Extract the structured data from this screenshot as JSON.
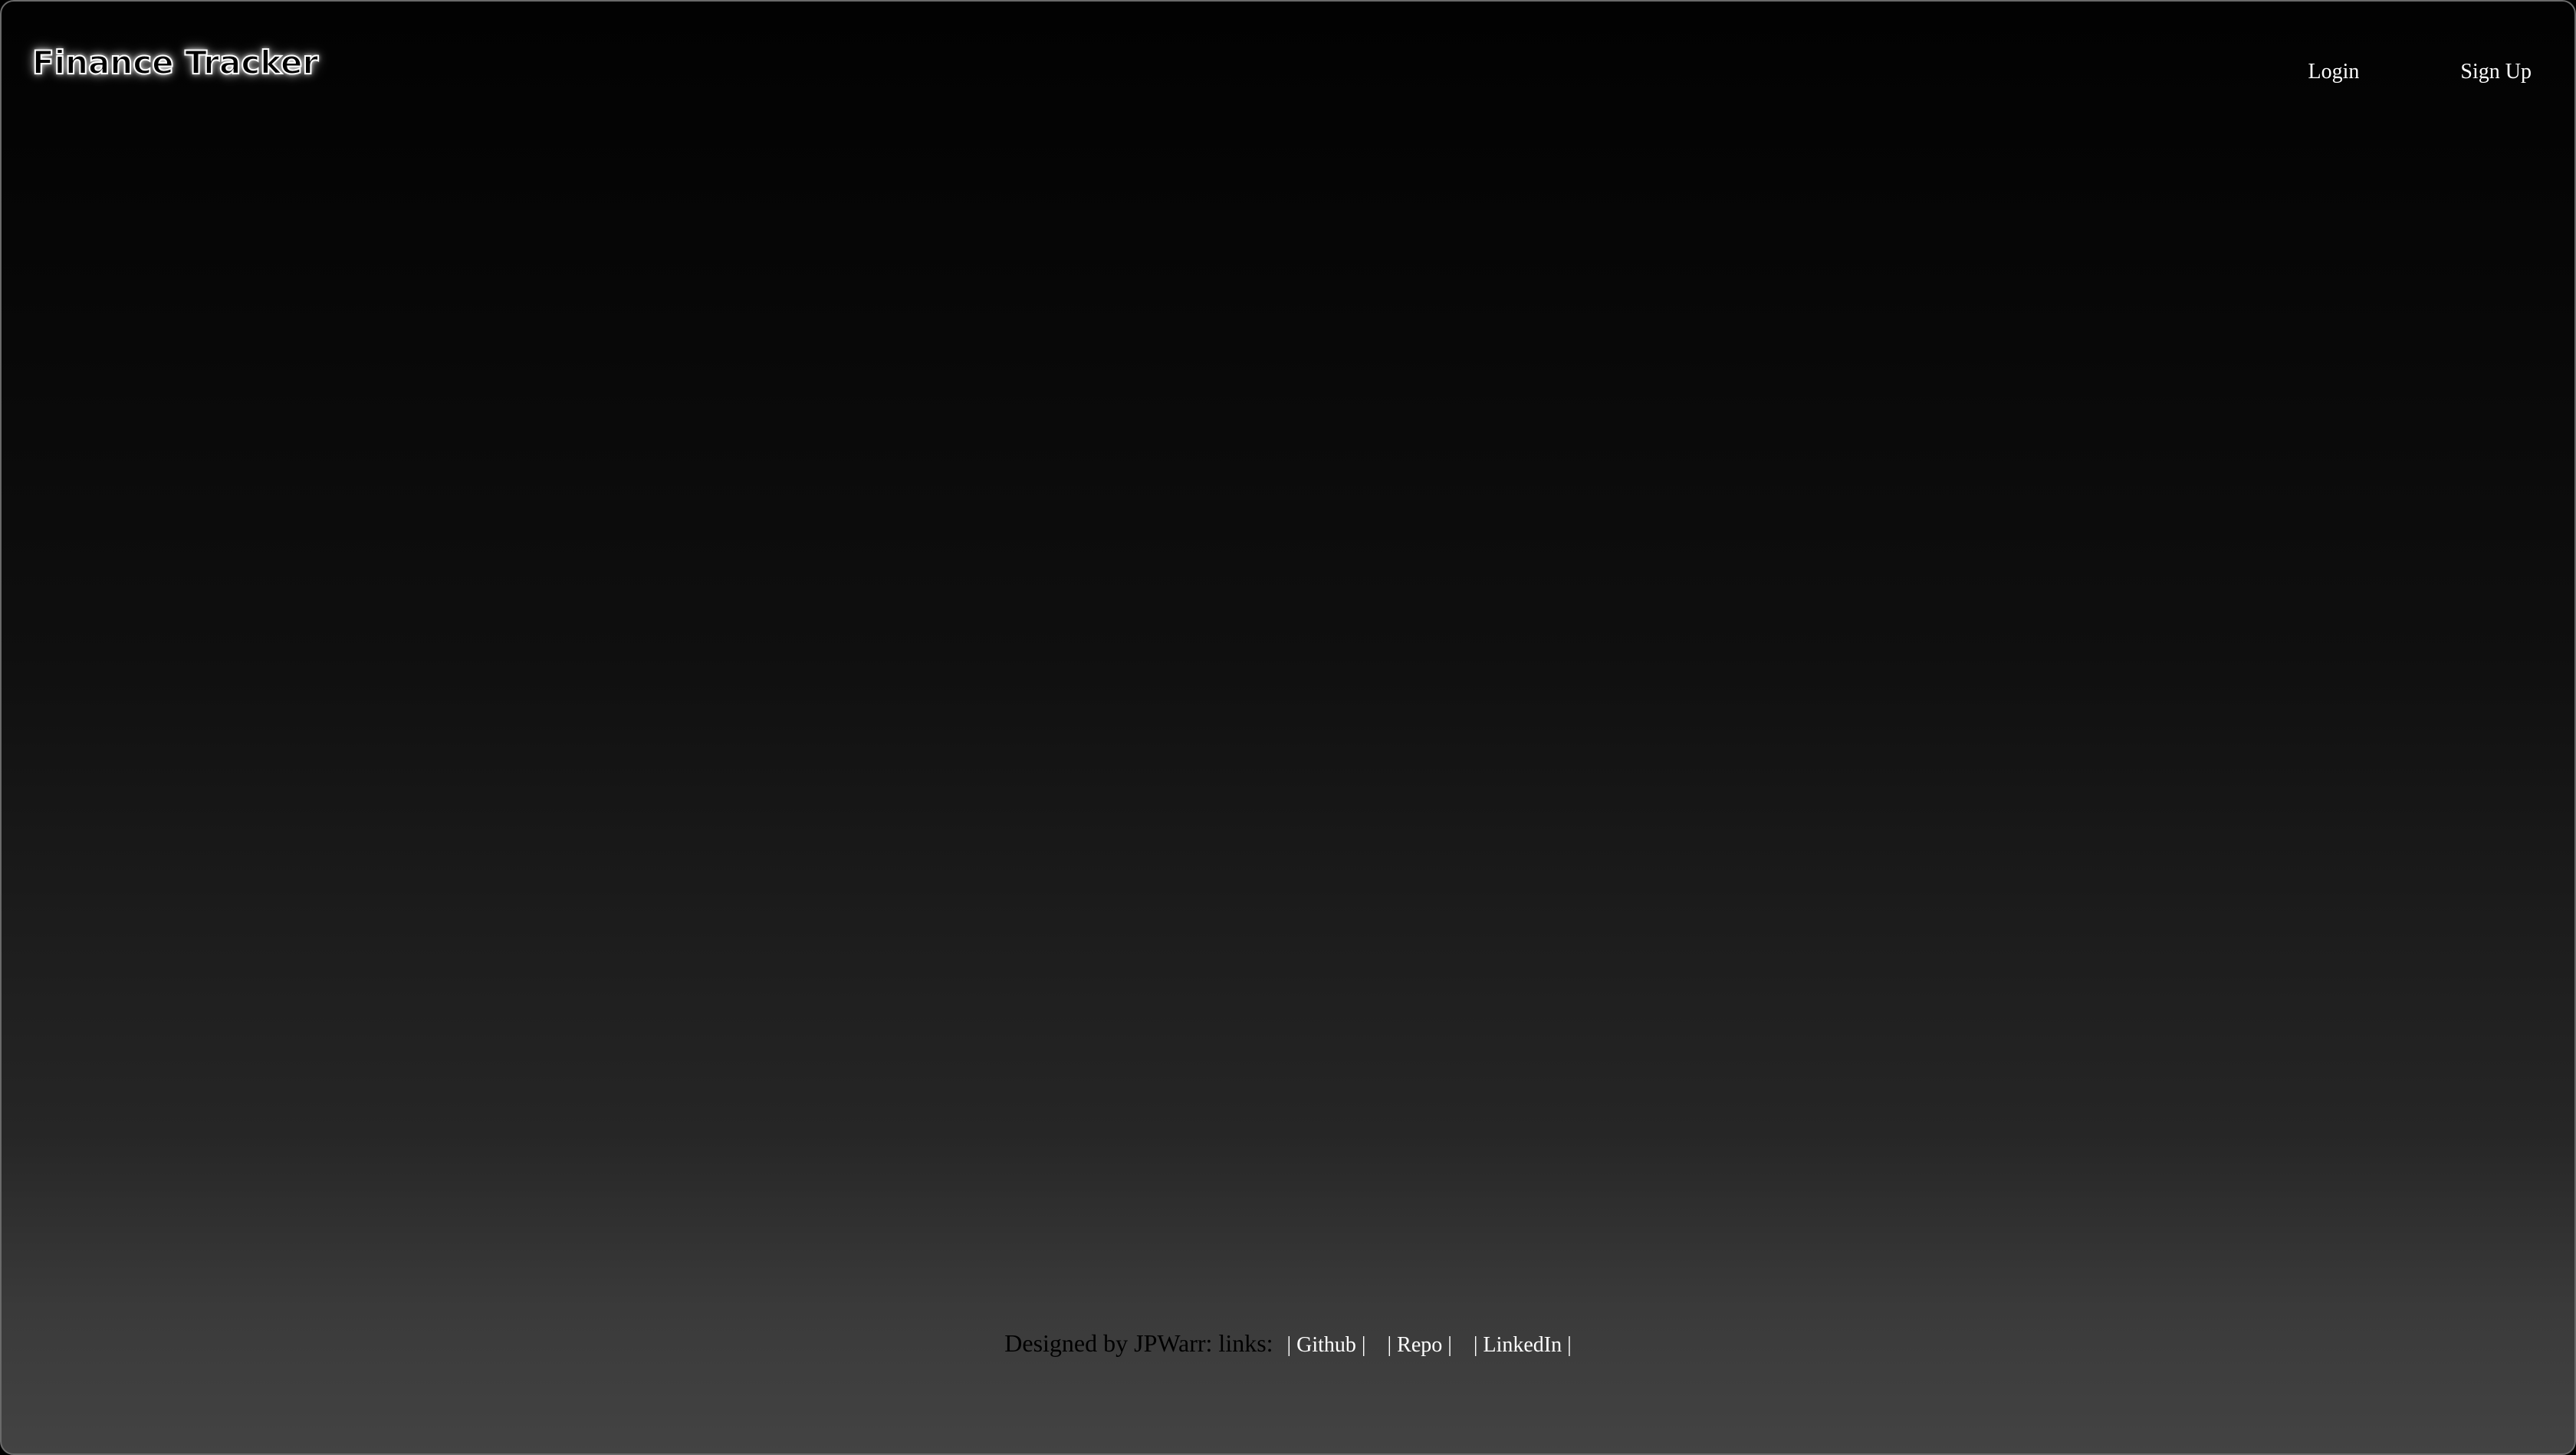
{
  "header": {
    "brand": "Finance Tracker",
    "nav": {
      "login_label": "Login",
      "signup_label": "Sign Up"
    }
  },
  "footer": {
    "credit": "Designed by JPWarr: links:",
    "links": [
      {
        "label": "| Github |"
      },
      {
        "label": "| Repo |"
      },
      {
        "label": "| LinkedIn |"
      }
    ]
  },
  "colors": {
    "background_top": "#020202",
    "background_bottom": "#434343",
    "text_primary": "#ffffff",
    "footer_text": "#000000"
  }
}
